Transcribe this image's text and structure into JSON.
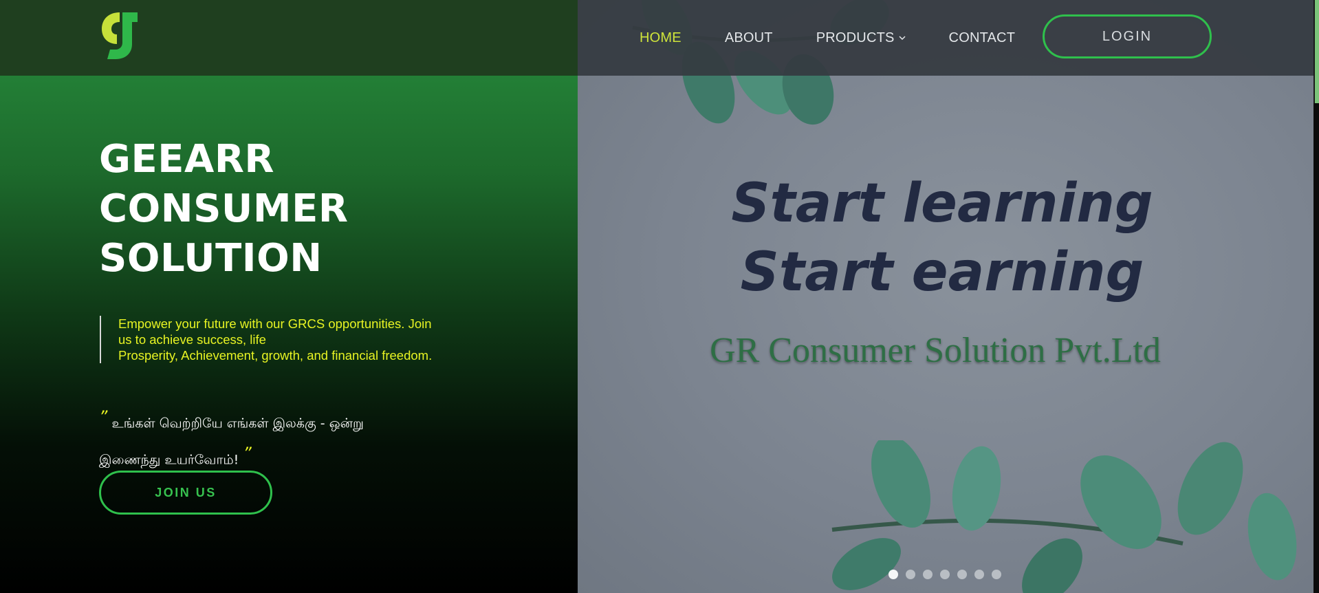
{
  "brand": {
    "logo_icon": "geearr-logo-icon",
    "green": "#2fc04c",
    "lime": "#cfe43a"
  },
  "nav": {
    "items": [
      {
        "label": "HOME",
        "active": true
      },
      {
        "label": "ABOUT",
        "active": false
      },
      {
        "label": "PRODUCTS",
        "active": false,
        "icon": "chevron-down-icon"
      },
      {
        "label": "CONTACT",
        "active": false
      }
    ],
    "login_label": "LOGIN"
  },
  "hero": {
    "title_lines": [
      "GEEARR",
      "CONSUMER",
      "SOLUTION"
    ],
    "quote_lines": [
      "Empower your future with our GRCS opportunities. Join",
      "us to achieve success, life",
      "Prosperity, Achievement, growth, and financial freedom."
    ],
    "tamil_open_mark": "”",
    "tamil_line1": "உங்கள் வெற்றியே எங்கள் இலக்கு - ஒன்று",
    "tamil_line2": "இணைந்து உயர்வோம்!",
    "tamil_close_mark": "”",
    "join_label": "JOIN US"
  },
  "slide": {
    "headline_lines": [
      "Start learning",
      "Start earning"
    ],
    "subtitle": "GR Consumer Solution Pvt.Ltd",
    "dot_count": 7,
    "active_dot": 1
  }
}
